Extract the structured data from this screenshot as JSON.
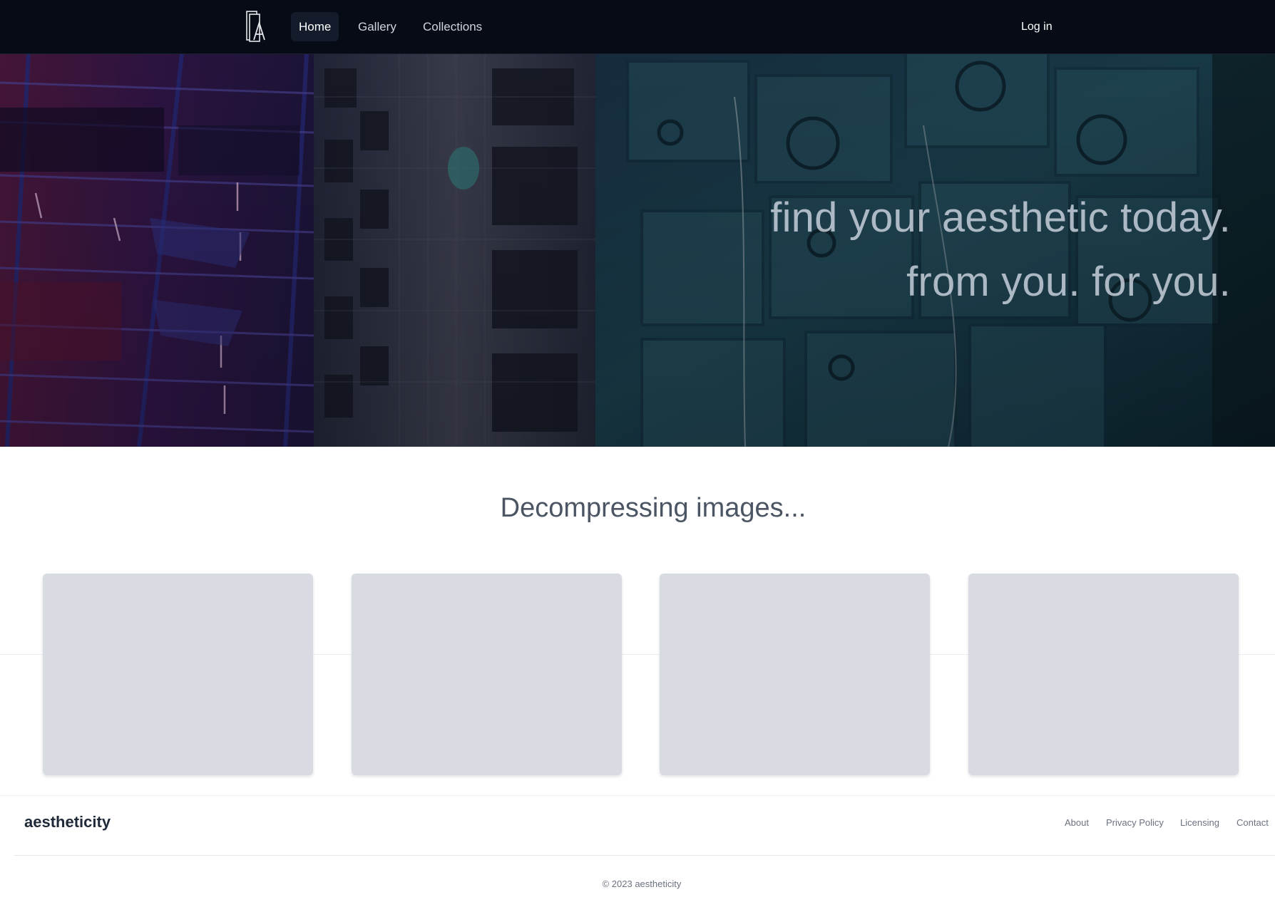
{
  "nav": {
    "logo_icon": "aesthetic-logo-icon",
    "items": [
      {
        "label": "Home",
        "active": true
      },
      {
        "label": "Gallery",
        "active": false
      },
      {
        "label": "Collections",
        "active": false
      }
    ],
    "login_label": "Log in"
  },
  "hero": {
    "image": "night-city-buildings-photo",
    "line1": "find your aesthetic today.",
    "line2": "from you. for you."
  },
  "loading": {
    "title": "Decompressing images...",
    "placeholder_count": 4
  },
  "footer": {
    "brand": "aestheticity",
    "links": [
      "About",
      "Privacy Policy",
      "Licensing",
      "Contact"
    ],
    "copyright": "© 2023 aestheticity"
  },
  "colors": {
    "nav_bg": "#060b16",
    "active_tab_bg": "#141c2b",
    "placeholder": "#d8dbe2",
    "heading_text": "#4b5563"
  }
}
